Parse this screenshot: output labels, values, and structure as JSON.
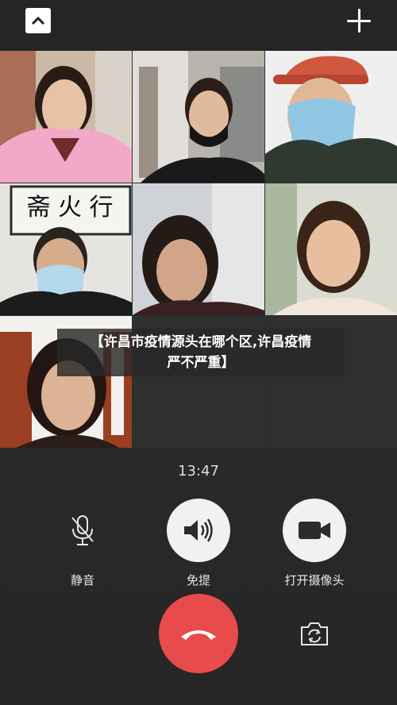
{
  "caption": {
    "line1": "【许昌市疫情源头在哪个区,许昌疫情",
    "line2": "严不严重】"
  },
  "call": {
    "timer": "13:47"
  },
  "controls": {
    "mute_label": "静音",
    "speaker_label": "免提",
    "camera_label": "打开摄像头"
  },
  "background_poster": {
    "text": "斋 火 行"
  },
  "icons": {
    "collapse": "chevron-up-icon",
    "add": "plus-icon",
    "mute": "microphone-off-icon",
    "speaker": "speaker-icon",
    "camera": "video-camera-icon",
    "hangup": "phone-hangup-icon",
    "switch": "camera-switch-icon"
  },
  "colors": {
    "hangup": "#e84b4b",
    "control_bg": "#f1f1f1",
    "background": "#2b2b2b"
  }
}
